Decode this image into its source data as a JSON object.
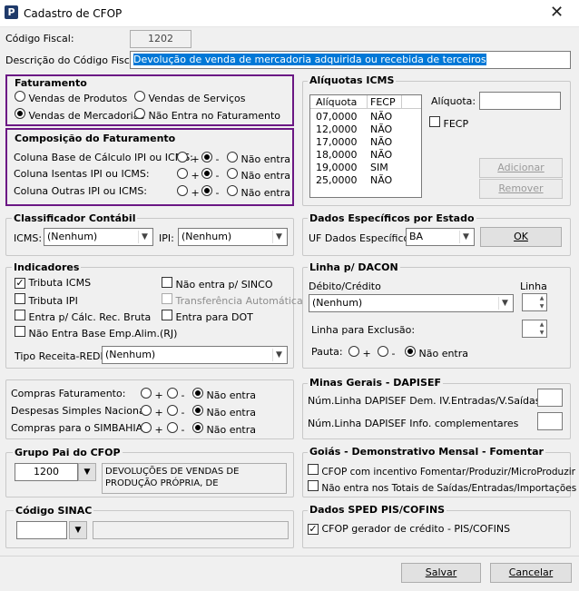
{
  "window": {
    "title": "Cadastro de CFOP",
    "app_icon_letter": "P",
    "close_glyph": "✕"
  },
  "header": {
    "codigo_label": "Código Fiscal:",
    "codigo_value": "1202",
    "descricao_label": "Descrição do Código Fiscal:",
    "descricao_value": "Devolução de venda de mercadoria adquirida ou recebida de terceiros"
  },
  "faturamento": {
    "title": "Faturamento",
    "vendas_produtos": "Vendas de Produtos",
    "vendas_servicos": "Vendas de Serviços",
    "vendas_mercadorias": "Vendas de Mercadorias",
    "nao_entra": "Não Entra no Faturamento"
  },
  "composicao": {
    "title": "Composição do Faturamento",
    "rows": [
      {
        "label": "Coluna Base de Cálculo IPI ou ICMS:"
      },
      {
        "label": "Coluna Isentas IPI ou ICMS:"
      },
      {
        "label": "Coluna Outras IPI ou ICMS:"
      }
    ],
    "plus": "+",
    "minus": "-",
    "nao_entra": "Não entra"
  },
  "aliquotas": {
    "title": "Alíquotas ICMS",
    "col_aliquota": "Alíquota",
    "col_fecp": "FECP",
    "rows": [
      {
        "aliquota": "07,0000",
        "fecp": "NÃO"
      },
      {
        "aliquota": "12,0000",
        "fecp": "NÃO"
      },
      {
        "aliquota": "17,0000",
        "fecp": "NÃO"
      },
      {
        "aliquota": "18,0000",
        "fecp": "NÃO"
      },
      {
        "aliquota": "19,0000",
        "fecp": "SIM"
      },
      {
        "aliquota": "25,0000",
        "fecp": "NÃO"
      }
    ],
    "aliquota_label": "Alíquota:",
    "fecp_label": "FECP",
    "adicionar": "Adicionar",
    "remover": "Remover"
  },
  "classificador": {
    "title": "Classificador Contábil",
    "icms_label": "ICMS:",
    "icms_value": "(Nenhum)",
    "ipi_label": "IPI:",
    "ipi_value": "(Nenhum)"
  },
  "dados_estado": {
    "title": "Dados Específicos por Estado",
    "uf_label": "UF Dados Específicos:",
    "uf_value": "BA",
    "ok": "OK"
  },
  "indicadores": {
    "title": "Indicadores",
    "tributa_icms": "Tributa ICMS",
    "tributa_ipi": "Tributa IPI",
    "entra_calc": "Entra p/ Cálc. Rec. Bruta",
    "nao_entra_base": "Não Entra Base Emp.Alim.(RJ)",
    "nao_entra_sinco": "Não entra p/ SINCO",
    "transferencia": "Transferência Automática",
    "entra_dot": "Entra para DOT",
    "tipo_receita_label": "Tipo Receita-REDF:",
    "tipo_receita_value": "(Nenhum)"
  },
  "dacon": {
    "title": "Linha p/ DACON",
    "debito_label": "Débito/Crédito",
    "debito_value": "(Nenhum)",
    "linha_label": "Linha",
    "exclusao_label": "Linha para Exclusão:",
    "pauta_label": "Pauta:",
    "plus": "+",
    "minus": "-",
    "nao_entra": "Não entra"
  },
  "compras": {
    "rows": [
      {
        "label": "Compras Faturamento:"
      },
      {
        "label": "Despesas Simples Nacional:"
      },
      {
        "label": "Compras para o SIMBAHIA:"
      }
    ],
    "plus": "+",
    "minus": "-",
    "nao_entra": "Não entra"
  },
  "minas": {
    "title": "Minas Gerais - DAPISEF",
    "row1": "Núm.Linha DAPISEF Dem. IV.Entradas/V.Saídas",
    "row2": "Núm.Linha DAPISEF Info. complementares"
  },
  "grupo_pai": {
    "title": "Grupo Pai do CFOP",
    "value": "1200",
    "description": "DEVOLUÇÕES DE VENDAS DE PRODUÇÃO PRÓPRIA, DE"
  },
  "goias": {
    "title": "Goiás - Demonstrativo Mensal - Fomentar",
    "opt1": "CFOP com incentivo  Fomentar/Produzir/MicroProduzir",
    "opt2": "Não entra nos Totais de  Saídas/Entradas/Importações"
  },
  "sinac": {
    "title": "Código SINAC"
  },
  "sped": {
    "title": "Dados SPED PIS/COFINS",
    "gerador": "CFOP gerador de crédito - PIS/COFINS"
  },
  "footer": {
    "salvar": "Salvar",
    "cancelar": "Cancelar"
  }
}
